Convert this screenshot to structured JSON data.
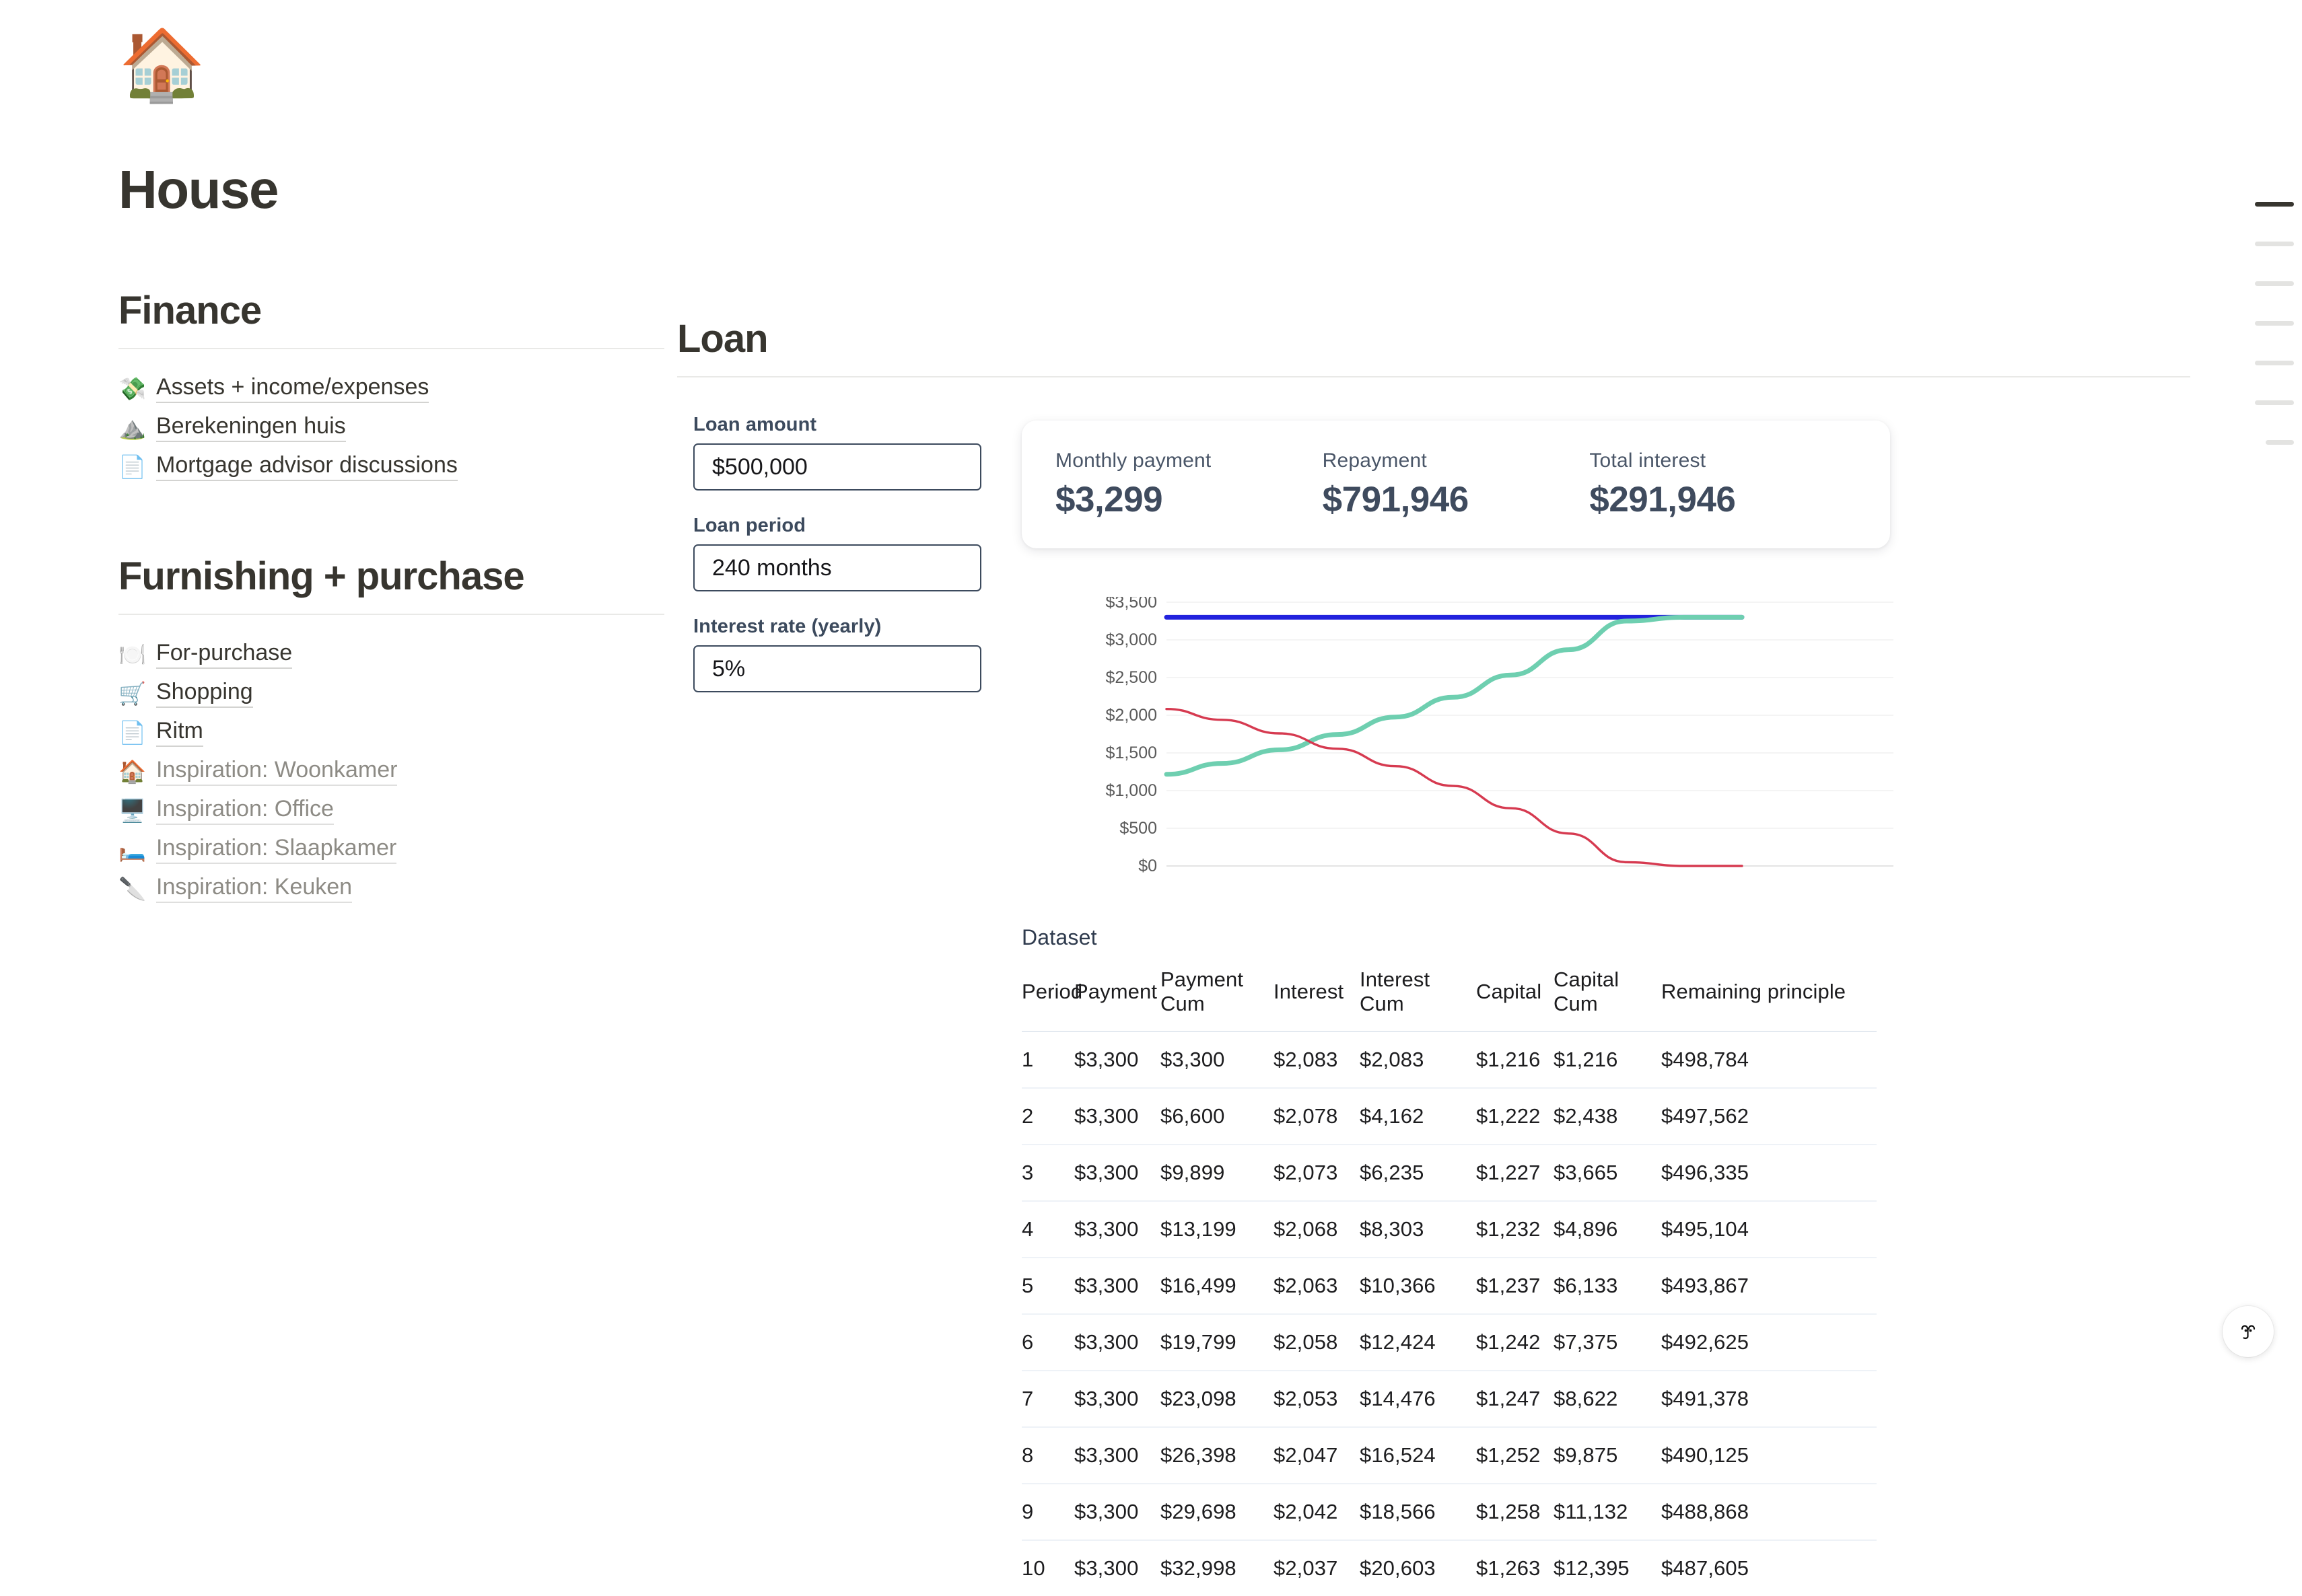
{
  "page": {
    "emoji": "🏠",
    "emoji_name": "house-emoji",
    "title": "House"
  },
  "sidebar": {
    "sections": [
      {
        "heading": "Finance",
        "items": [
          {
            "emoji": "💸",
            "label": "Assets + income/expenses",
            "muted": false
          },
          {
            "emoji": "⛰️",
            "label": "Berekeningen huis",
            "muted": false
          },
          {
            "emoji": "📄",
            "label": "Mortgage advisor discussions",
            "muted": false
          }
        ]
      },
      {
        "heading": "Furnishing + purchase",
        "items": [
          {
            "emoji": "🍽️",
            "label": "For-purchase",
            "muted": false
          },
          {
            "emoji": "🛒",
            "label": "Shopping",
            "muted": false
          },
          {
            "emoji": "📄",
            "label": "Ritm",
            "muted": false
          },
          {
            "emoji": "🏠",
            "label": "Inspiration: Woonkamer",
            "muted": true
          },
          {
            "emoji": "🖥️",
            "label": "Inspiration: Office",
            "muted": true
          },
          {
            "emoji": "🛏️",
            "label": "Inspiration: Slaapkamer",
            "muted": true
          },
          {
            "emoji": "🔪",
            "label": "Inspiration: Keuken",
            "muted": true
          }
        ]
      }
    ]
  },
  "main": {
    "heading": "Loan",
    "inputs": [
      {
        "label": "Loan amount",
        "value": "$500,000"
      },
      {
        "label": "Loan period",
        "value": "240 months"
      },
      {
        "label": "Interest rate (yearly)",
        "value": "5%"
      }
    ],
    "summary": [
      {
        "label": "Monthly payment",
        "value": "$3,299"
      },
      {
        "label": "Repayment",
        "value": "$791,946"
      },
      {
        "label": "Total interest",
        "value": "$291,946"
      }
    ],
    "dataset": {
      "title": "Dataset",
      "columns": [
        "Period",
        "Payment",
        "Payment Cum",
        "Interest",
        "Interest Cum",
        "Capital",
        "Capital Cum",
        "Remaining principle"
      ],
      "rows": [
        [
          "1",
          "$3,300",
          "$3,300",
          "$2,083",
          "$2,083",
          "$1,216",
          "$1,216",
          "$498,784"
        ],
        [
          "2",
          "$3,300",
          "$6,600",
          "$2,078",
          "$4,162",
          "$1,222",
          "$2,438",
          "$497,562"
        ],
        [
          "3",
          "$3,300",
          "$9,899",
          "$2,073",
          "$6,235",
          "$1,227",
          "$3,665",
          "$496,335"
        ],
        [
          "4",
          "$3,300",
          "$13,199",
          "$2,068",
          "$8,303",
          "$1,232",
          "$4,896",
          "$495,104"
        ],
        [
          "5",
          "$3,300",
          "$16,499",
          "$2,063",
          "$10,366",
          "$1,237",
          "$6,133",
          "$493,867"
        ],
        [
          "6",
          "$3,300",
          "$19,799",
          "$2,058",
          "$12,424",
          "$1,242",
          "$7,375",
          "$492,625"
        ],
        [
          "7",
          "$3,300",
          "$23,098",
          "$2,053",
          "$14,476",
          "$1,247",
          "$8,622",
          "$491,378"
        ],
        [
          "8",
          "$3,300",
          "$26,398",
          "$2,047",
          "$16,524",
          "$1,252",
          "$9,875",
          "$490,125"
        ],
        [
          "9",
          "$3,300",
          "$29,698",
          "$2,042",
          "$18,566",
          "$1,258",
          "$11,132",
          "$488,868"
        ],
        [
          "10",
          "$3,300",
          "$32,998",
          "$2,037",
          "$20,603",
          "$1,263",
          "$12,395",
          "$487,605"
        ]
      ]
    }
  },
  "toc": {
    "bars": [
      {
        "width": 58,
        "active": true
      },
      {
        "width": 58,
        "active": false
      },
      {
        "width": 58,
        "active": false
      },
      {
        "width": 58,
        "active": false
      },
      {
        "width": 58,
        "active": false
      },
      {
        "width": 58,
        "active": false
      },
      {
        "width": 42,
        "active": false
      }
    ]
  },
  "help_button": {
    "icon": "face-icon"
  },
  "chart_data": {
    "type": "line",
    "title": "",
    "xlabel": "",
    "ylabel": "",
    "ylim": [
      0,
      3500
    ],
    "yticks": [
      0,
      500,
      1000,
      1500,
      2000,
      2500,
      3000,
      3500
    ],
    "ytick_labels": [
      "$0",
      "$500",
      "$1,000",
      "$1,500",
      "$2,000",
      "$2,500",
      "$3,000",
      "$3,500"
    ],
    "grid": true,
    "legend": "none",
    "x": [
      1,
      24,
      48,
      72,
      96,
      120,
      144,
      168,
      192,
      216,
      240
    ],
    "series": [
      {
        "name": "Payment",
        "color": "#2222dd",
        "values": [
          3300,
          3300,
          3300,
          3300,
          3300,
          3300,
          3300,
          3300,
          3300,
          3300,
          3300
        ]
      },
      {
        "name": "Capital",
        "color": "#6ecfb0",
        "values": [
          1216,
          1361,
          1541,
          1745,
          1976,
          2238,
          2534,
          2870,
          3250,
          3300,
          3300
        ]
      },
      {
        "name": "Interest",
        "color": "#d63a50",
        "values": [
          2083,
          1939,
          1759,
          1555,
          1324,
          1062,
          766,
          430,
          50,
          0,
          0
        ]
      }
    ]
  }
}
